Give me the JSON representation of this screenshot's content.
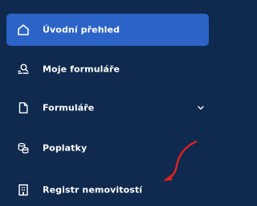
{
  "sidebar": {
    "items": [
      {
        "label": "Úvodní přehled",
        "icon": "home-icon",
        "active": true
      },
      {
        "label": "Moje formuláře",
        "icon": "user-search-icon",
        "active": false
      },
      {
        "label": "Formuláře",
        "icon": "document-icon",
        "active": false,
        "expandable": true
      },
      {
        "label": "Poplatky",
        "icon": "coins-icon",
        "active": false
      },
      {
        "label": "Registr nemovitostí",
        "icon": "building-icon",
        "active": false
      }
    ]
  },
  "colors": {
    "background": "#0f2a4e",
    "active_background": "#2b63c7",
    "text": "#ffffff",
    "annotation_arrow": "#e02020"
  }
}
